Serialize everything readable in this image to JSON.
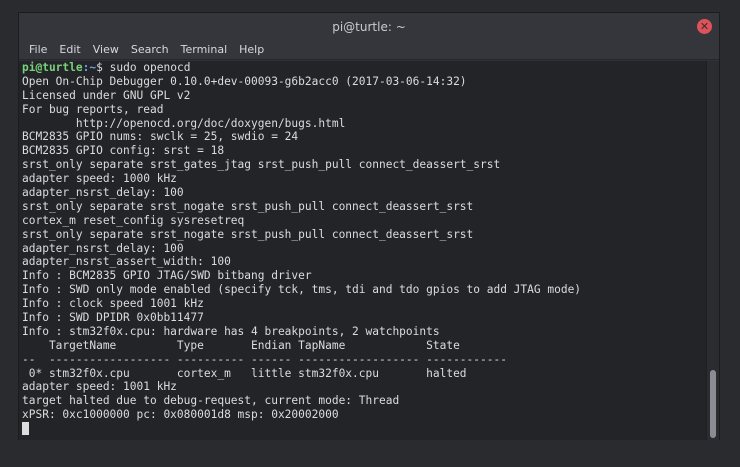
{
  "window": {
    "title": "pi@turtle: ~"
  },
  "menu": [
    "File",
    "Edit",
    "View",
    "Search",
    "Terminal",
    "Help"
  ],
  "prompt": {
    "user_host": "pi@turtle",
    "sep": ":",
    "path": "~",
    "symbol": "$",
    "command": "sudo openocd"
  },
  "output": [
    "Open On-Chip Debugger 0.10.0+dev-00093-g6b2acc0 (2017-03-06-14:32)",
    "Licensed under GNU GPL v2",
    "For bug reports, read",
    "        http://openocd.org/doc/doxygen/bugs.html",
    "BCM2835 GPIO nums: swclk = 25, swdio = 24",
    "BCM2835 GPIO config: srst = 18",
    "srst_only separate srst_gates_jtag srst_push_pull connect_deassert_srst",
    "adapter speed: 1000 kHz",
    "adapter_nsrst_delay: 100",
    "srst_only separate srst_nogate srst_push_pull connect_deassert_srst",
    "cortex_m reset_config sysresetreq",
    "srst_only separate srst_nogate srst_push_pull connect_deassert_srst",
    "adapter_nsrst_delay: 100",
    "adapter_nsrst_assert_width: 100",
    "Info : BCM2835 GPIO JTAG/SWD bitbang driver",
    "Info : SWD only mode enabled (specify tck, tms, tdi and tdo gpios to add JTAG mode)",
    "Info : clock speed 1001 kHz",
    "Info : SWD DPIDR 0x0bb11477",
    "Info : stm32f0x.cpu: hardware has 4 breakpoints, 2 watchpoints",
    "    TargetName         Type       Endian TapName            State",
    "--  ------------------ ---------- ------ ------------------ ------------",
    " 0* stm32f0x.cpu       cortex_m   little stm32f0x.cpu       halted",
    "adapter speed: 1001 kHz",
    "target halted due to debug-request, current mode: Thread",
    "xPSR: 0xc1000000 pc: 0x080001d8 msp: 0x20002000"
  ],
  "icons": {
    "close": "close-icon"
  }
}
